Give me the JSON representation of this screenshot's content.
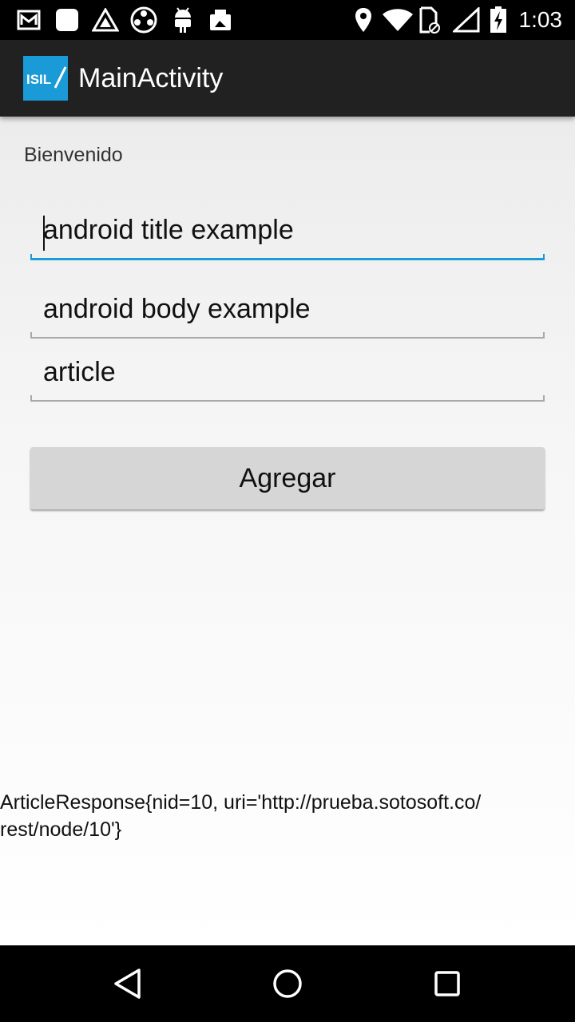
{
  "status_bar": {
    "time": "1:03",
    "left_icons": [
      "gmail-icon",
      "notification-square-icon",
      "triangle-app-icon",
      "reel-icon",
      "android-icon",
      "photos-icon"
    ],
    "right_icons": [
      "location-icon",
      "wifi-icon",
      "sim-icon",
      "signal-icon",
      "battery-icon"
    ]
  },
  "app_bar": {
    "logo_text": "ISIL",
    "title": "MainActivity",
    "accent_color": "#1a9ad6",
    "background_color": "#212121"
  },
  "content": {
    "welcome": "Bienvenido",
    "fields": [
      {
        "value": "android title example",
        "focused": true
      },
      {
        "value": "android body example",
        "focused": false
      },
      {
        "value": "article",
        "focused": false
      }
    ],
    "button_label": "Agregar",
    "response_text": "ArticleResponse{nid=10, uri='http://prueba.sotosoft.co/\nrest/node/10'}"
  },
  "nav_bar": {
    "buttons": [
      "back-icon",
      "home-icon",
      "recents-icon"
    ]
  }
}
